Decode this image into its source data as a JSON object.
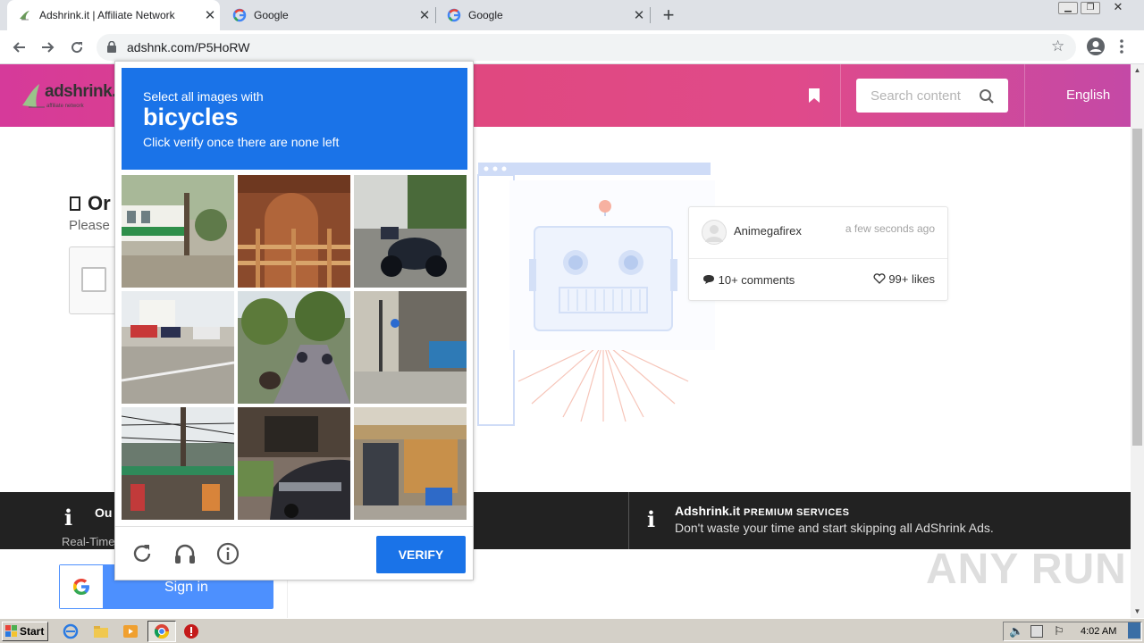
{
  "browser": {
    "tabs": [
      {
        "title": "Adshrink.it | Affiliate Network",
        "active": true,
        "icon": "adshrink-favicon"
      },
      {
        "title": "Google",
        "active": false,
        "icon": "google-favicon"
      },
      {
        "title": "Google",
        "active": false,
        "icon": "google-favicon"
      }
    ],
    "url": "adshnk.com/P5HoRW"
  },
  "site": {
    "logo_text": "adshrink.it",
    "logo_sub": "affiliate network",
    "search_placeholder": "Search content",
    "language": "English"
  },
  "main": {
    "title_fragment": "Or",
    "subtitle_fragment": "Please",
    "author": "Animegafirex",
    "time": "a few seconds ago",
    "comments": "10+ comments",
    "likes": "99+ likes"
  },
  "band": {
    "left_title": "Ou",
    "left_sub": "Real-Time",
    "premium_brand": "Adshrink.it",
    "premium_label": "PREMIUM SERVICES",
    "premium_desc": "Don't waste your time and start skipping all AdShrink Ads."
  },
  "signin": {
    "label": "Sign in",
    "g": "G"
  },
  "watermark": "ANY RUN",
  "captcha": {
    "line1": "Select all images with",
    "keyword": "bicycles",
    "line3": "Click verify once there are none left",
    "verify": "VERIFY",
    "tiles": [
      "bus-street-scene",
      "brick-building-window",
      "parked-motorcycle",
      "intersection-cars",
      "tree-lined-road-motorbikes",
      "street-corner-buildings",
      "market-stall-wires",
      "cafe-parked-car",
      "shop-front-stall"
    ]
  },
  "taskbar": {
    "start": "Start",
    "clock": "4:02 AM"
  },
  "colors": {
    "captcha_blue": "#1a73e8",
    "header_pink": "#e0487f",
    "dark_band": "#222222"
  }
}
